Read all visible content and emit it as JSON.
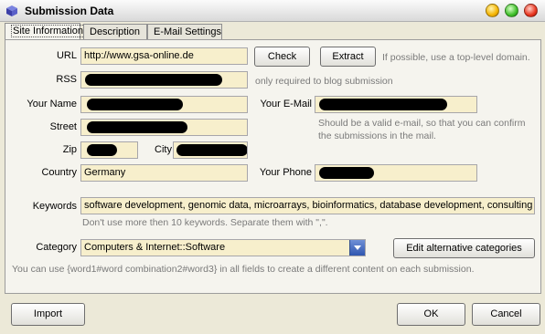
{
  "window": {
    "title": "Submission Data"
  },
  "tabs": [
    {
      "label": "Site Information"
    },
    {
      "label": "Description"
    },
    {
      "label": "E-Mail Settings"
    }
  ],
  "form": {
    "url_label": "URL",
    "url_value": "http://www.gsa-online.de",
    "check_button": "Check",
    "extract_button": "Extract",
    "url_hint": "If possible, use a top-level domain.",
    "rss_label": "RSS",
    "rss_hint": "only required to blog submission",
    "name_label": "Your Name",
    "email_label": "Your E-Mail",
    "email_hint_1": "Should be a valid e-mail, so that you can confirm",
    "email_hint_2": "the submissions in the mail.",
    "street_label": "Street",
    "zip_label": "Zip",
    "city_label": "City",
    "country_label": "Country",
    "country_value": "Germany",
    "phone_label": "Your Phone",
    "keywords_label": "Keywords",
    "keywords_value": "software development, genomic data, microarrays, bioinformatics, database development, consulting",
    "keywords_hint": "Don't use more then 10 keywords. Separate them with \",\".",
    "category_label": "Category",
    "category_value": "Computers & Internet::Software",
    "alt_categories_button": "Edit alternative categories",
    "footer_hint": "You can use {word1#word combination2#word3} in all fields to create a different content on each submission."
  },
  "buttons": {
    "import": "Import",
    "ok": "OK",
    "cancel": "Cancel"
  }
}
